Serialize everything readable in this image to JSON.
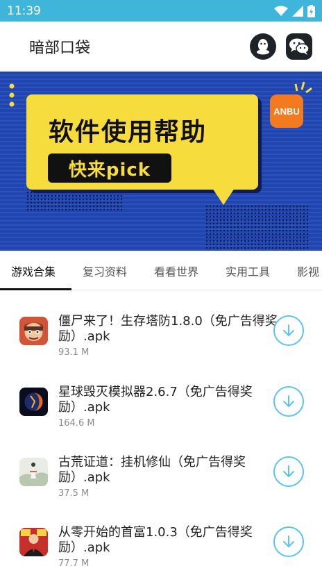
{
  "status_bar": {
    "time": "11:39"
  },
  "header": {
    "title": "暗部口袋"
  },
  "banner": {
    "headline": "软件使用帮助",
    "pill": "快来pick",
    "badge": "ANBU"
  },
  "tabs": [
    {
      "label": "游戏合集",
      "active": true
    },
    {
      "label": "复习资料",
      "active": false
    },
    {
      "label": "看看世界",
      "active": false
    },
    {
      "label": "实用工具",
      "active": false
    },
    {
      "label": "影视",
      "active": false
    }
  ],
  "apps": [
    {
      "name": "僵尸来了！生存塔防1.8.0（免广告得奖励）.apk",
      "size": "93.1 M"
    },
    {
      "name": "星球毁灭模拟器2.6.7（免广告得奖励）.apk",
      "size": "164.6 M"
    },
    {
      "name": "古荒证道：挂机修仙（免广告得奖励）.apk",
      "size": "37.5 M"
    },
    {
      "name": "从零开始的首富1.0.3（免广告得奖励）.apk",
      "size": "77.7 M"
    }
  ],
  "colors": {
    "status_bar": "#3fb6d9",
    "banner_bg": "#1f45b2",
    "banner_yellow": "#f7dc3d",
    "badge_orange": "#f47a1f",
    "download_accent": "#5ac3f0"
  },
  "icons": {
    "header_left_button": "qq-penguin-icon",
    "header_right_button": "wechat-icon",
    "download": "download-arrow-icon"
  }
}
